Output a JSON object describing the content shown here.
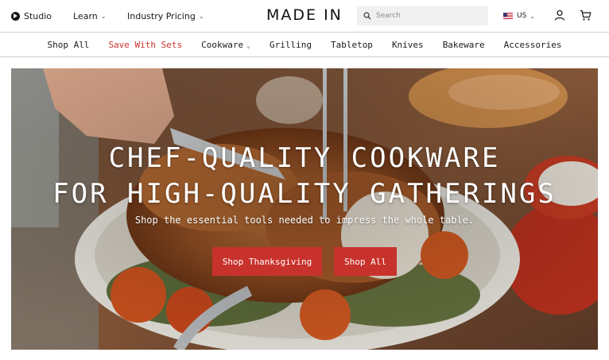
{
  "header": {
    "studio_label": "Studio",
    "learn_label": "Learn",
    "pricing_label": "Industry Pricing",
    "logo_text": "MADE IN",
    "search_placeholder": "Search",
    "locale_label": "US"
  },
  "nav": {
    "items": [
      {
        "label": "Shop All"
      },
      {
        "label": "Save With Sets"
      },
      {
        "label": "Cookware"
      },
      {
        "label": "Grilling"
      },
      {
        "label": "Tabletop"
      },
      {
        "label": "Knives"
      },
      {
        "label": "Bakeware"
      },
      {
        "label": "Accessories"
      }
    ]
  },
  "hero": {
    "headline_line1": "CHEF-QUALITY COOKWARE",
    "headline_line2": "FOR HIGH-QUALITY GATHERINGS",
    "subheading": "Shop the essential tools needed to impress the whole table.",
    "primary_cta": "Shop Thanksgiving",
    "secondary_cta": "Shop All"
  },
  "colors": {
    "accent": "#c8322c",
    "text": "#1a1a1a",
    "border": "#cfcfcf"
  },
  "icons": [
    "play-icon",
    "chevron-down-icon",
    "search-icon",
    "us-flag-icon",
    "account-icon",
    "cart-icon"
  ]
}
